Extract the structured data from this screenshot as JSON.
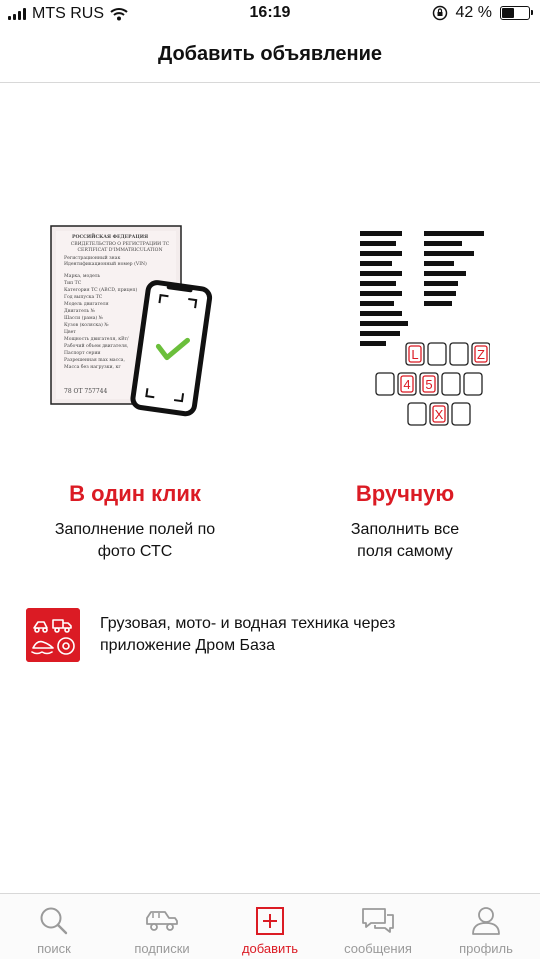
{
  "status_bar": {
    "carrier": "MTS RUS",
    "time": "16:19",
    "battery_percent": "42 %",
    "battery_level": 0.42
  },
  "header": {
    "title": "Добавить объявление"
  },
  "options": {
    "photo": {
      "title": "В один клик",
      "description": "Заполнение полей по\nфото СТС",
      "icon": "sts-photo-illustration",
      "document_lines": [
        "РОССИЙСКАЯ ФЕДЕРАЦИЯ",
        "СВИДЕТЕЛЬСТВО О РЕГИСТРАЦИИ ТС",
        "CERTIFICAT D'IMMATRICULATION",
        "Регистрационный знак",
        "Идентификационный номер (VIN)",
        "Марка, модель",
        "Тип ТС",
        "Категория ТС (ABCD, прицеп)",
        "Год выпуска ТС",
        "Модель двигателя",
        "Двигатель №",
        "Шасси (рама) №",
        "Кузов (коляска) №",
        "Цвет",
        "Мощность двигателя, кВт/",
        "Рабочий объем двигателя,",
        "Паспорт серии",
        "Разрешенная max масса,",
        "Масса без нагрузки, кг",
        "78 ОТ 757744"
      ]
    },
    "manual": {
      "title": "Вручную",
      "description": "Заполнить все\nполя самому",
      "icon": "keyboard-form-illustration",
      "keys": [
        "L",
        "Z",
        "4",
        "5",
        "X"
      ]
    }
  },
  "promo": {
    "text": "Грузовая, мото- и водная техника через\nприложение Дром База",
    "icon": "drom-baza-logo"
  },
  "tabbar": {
    "tabs": [
      {
        "label": "поиск",
        "icon": "search-icon"
      },
      {
        "label": "подписки",
        "icon": "car-icon"
      },
      {
        "label": "добавить",
        "icon": "add-icon"
      },
      {
        "label": "сообщения",
        "icon": "chat-icon"
      },
      {
        "label": "профиль",
        "icon": "profile-icon"
      }
    ],
    "active_index": 2
  },
  "colors": {
    "accent": "#db1b24",
    "check": "#6bbf3b",
    "inactive": "#9a9a9a"
  }
}
